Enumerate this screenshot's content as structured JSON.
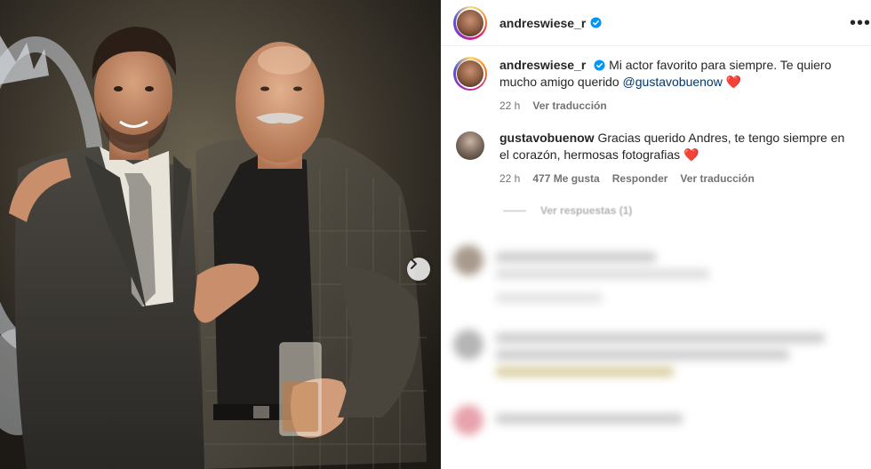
{
  "post": {
    "author": "andreswiese_r",
    "verified": true,
    "more_menu_icon": "more-dots-icon",
    "next_icon": "chevron-right-icon"
  },
  "caption": {
    "username": "andreswiese_r",
    "text": "Mi actor favorito para siempre. Te quiero mucho amigo querido",
    "mention": "@gustavobuenow",
    "emoji": "❤️",
    "time": "22 h",
    "translate_label": "Ver traducción"
  },
  "comment": {
    "username": "gustavobuenow",
    "text": "Gracias querido Andres, te tengo siempre en el corazón, hermosas fotografias",
    "emoji": "❤️",
    "time": "22 h",
    "likes": "477 Me gusta",
    "reply_label": "Responder",
    "translate_label": "Ver traducción",
    "view_replies": "Ver respuestas (1)"
  },
  "colors": {
    "text": "#262626",
    "secondary": "#737373",
    "mention": "#00376b",
    "verified": "#0095f6",
    "heart": "#ed1c3a"
  }
}
